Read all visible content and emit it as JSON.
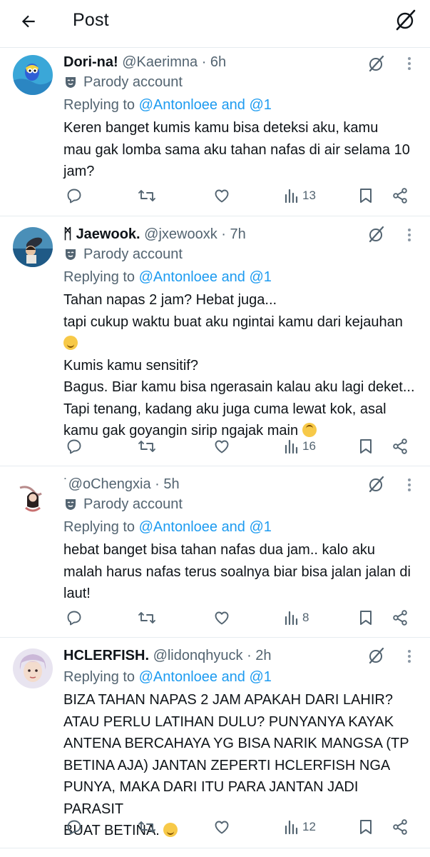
{
  "header": {
    "title": "Post",
    "back_icon": "arrow-left-icon",
    "grok_icon": "grok-icon"
  },
  "colors": {
    "link": "#1d9bf0",
    "secondary": "#536471",
    "text": "#0f1419",
    "divider": "#e6ecf0"
  },
  "replying_prefix": "Replying to ",
  "replying_targets": "@Antonloee and @1",
  "parody_label": "Parody account",
  "posts": [
    {
      "name": "Dori-na!",
      "handle": "@Kaerimna",
      "time": "· 6h",
      "lines": [
        "Keren banget kumis kamu bisa deteksi aku, kamu",
        "mau gak lomba sama aku tahan nafas di air selama 10",
        "jam?"
      ],
      "views": "13"
    },
    {
      "name": "Jaewook.",
      "name_prefix": "ᛗ",
      "handle": "@jxewooxk",
      "time": "· 7h",
      "lines": [
        "Tahan napas 2 jam? Hebat juga...",
        "tapi cukup waktu buat aku ngintai kamu dari kejauhan",
        "",
        "Kumis kamu sensitif?",
        "Bagus. Biar kamu bisa ngerasain kalau aku lagi deket...",
        "Tapi tenang, kadang aku juga cuma lewat kok, asal",
        "kamu gak goyangin sirip ngajak main"
      ],
      "views": "16"
    },
    {
      "name": "",
      "handle": "˙@oChengxia",
      "time": "· 5h",
      "lines": [
        "hebat banget bisa tahan nafas dua jam.. kalo aku",
        "malah harus nafas terus soalnya biar bisa jalan jalan di",
        "laut!"
      ],
      "views": "8"
    },
    {
      "name": "HCLERFISH.",
      "handle": "@lidonqhyuck",
      "time": "· 2h",
      "lines": [
        "BIZA TAHAN NAPAS 2 JAM APAKAH DARI LAHIR?",
        "ATAU PERLU LATIHAN DULU? PUNYANYA KAYAK",
        "ANTENA BERCAHAYA YG BISA NARIK MANGSA (TP",
        "BETINA AJA) JANTAN ZEPERTI HCLERFISH NGA",
        "PUNYA, MAKA DARI ITU PARA JANTAN JADI PARASIT",
        "BUAT BETINA."
      ],
      "views": "12"
    }
  ],
  "icons": {
    "reply": "reply-icon",
    "repost": "repost-icon",
    "like": "like-icon",
    "views": "views-icon",
    "bookmark": "bookmark-icon",
    "share": "share-icon",
    "more": "more-icon",
    "parody": "mask-icon"
  }
}
